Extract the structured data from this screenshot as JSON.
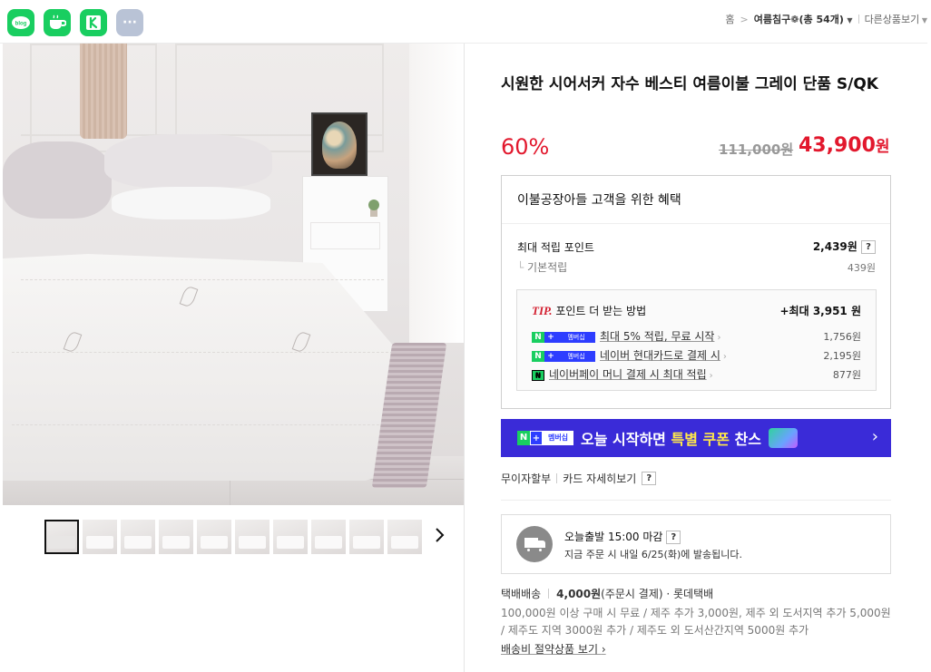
{
  "share": {
    "icons": [
      {
        "name": "blog-icon",
        "label": "blog",
        "color": "#19ce60"
      },
      {
        "name": "cafe-icon",
        "label": "",
        "color": "#19ce60"
      },
      {
        "name": "band-icon",
        "label": "",
        "color": "#19ce60"
      },
      {
        "name": "more-icon",
        "label": "···",
        "color": "#b9c3d6"
      }
    ]
  },
  "breadcrumb": {
    "home": "홈",
    "sep": ">",
    "category": "여름침구❁",
    "count": "(총 54개)",
    "other": "다른상품보기"
  },
  "product": {
    "title": "시원한 시어서커 자수 베스티 여름이불 그레이 단품 S/QK",
    "discount": "60%",
    "original_price": "111,000원",
    "sale_price": "43,900",
    "sale_unit": "원"
  },
  "benefits": {
    "title": "이불공장아들 고객을 위한 혜택",
    "max_points_label": "최대 적립 포인트",
    "max_points_value": "2,439원",
    "base_label": "기본적립",
    "base_value": "439원",
    "tip_label": "TIP.",
    "tip_text": "포인트 더 받는 방법",
    "tip_max": "+최대 3,951 원",
    "tips": [
      {
        "badge": "membership",
        "text": "최대 5% 적립, 무료 시작",
        "amount": "1,756원"
      },
      {
        "badge": "membership",
        "text": "네이버 현대카드로 결제 시",
        "amount": "2,195원"
      },
      {
        "badge": "pay",
        "text": "네이버페이 머니 결제 시 최대 적립",
        "amount": "877원"
      }
    ],
    "badge_n": "N",
    "badge_plus": "+",
    "badge_membership": "멤버십",
    "badge_pay": "₦"
  },
  "banner": {
    "text_1": "오늘 시작하면 ",
    "text_hl": "특별 쿠폰",
    "text_2": " 찬스",
    "arrow": "›",
    "color": "#3a2bd8"
  },
  "installment": {
    "label_1": "무이자할부",
    "label_2": "카드 자세히보기",
    "qmark": "?"
  },
  "shipping": {
    "title": "오늘출발 15:00 마감",
    "subtitle": "지금 주문 시 내일 6/25(화)에 발송됩니다."
  },
  "delivery": {
    "type": "택배배송",
    "fee": "4,000원",
    "fee_note": "(주문시 결제) · 롯데택배",
    "note": "100,000원 이상 구매 시 무료 / 제주 추가 3,000원, 제주 외 도서지역 추가 5,000원 / 제주도 지역 3000원 추가 / 제주도 외 도서산간지역 5000원 추가",
    "save_link": "배송비 절약상품 보기",
    "save_arrow": "›"
  },
  "thumbnails": {
    "count": 10,
    "next": "›"
  },
  "colors": {
    "price_red": "#e2182d",
    "naver_green": "#19ce60"
  }
}
